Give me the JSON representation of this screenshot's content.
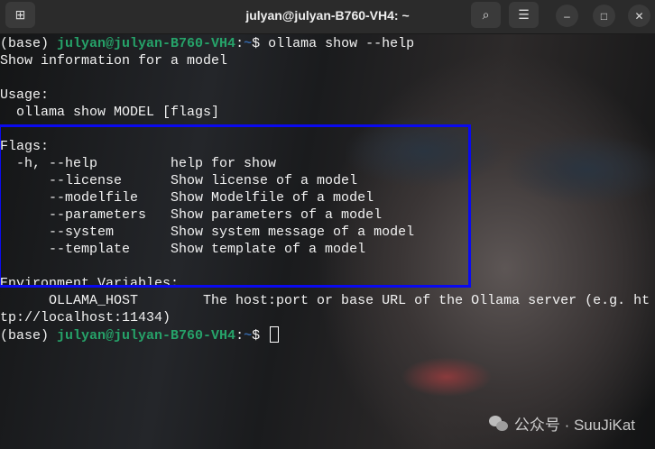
{
  "window": {
    "title": "julyan@julyan-B760-VH4: ~"
  },
  "prompt": {
    "env": "(base) ",
    "user_host": "julyan@julyan-B760-VH4",
    "colon": ":",
    "path": "~",
    "dollar": "$ "
  },
  "lines": [
    {
      "cmd": "ollama show --help"
    },
    "Show information for a model",
    "",
    "Usage:",
    "  ollama show MODEL [flags]",
    "",
    "Flags:",
    "  -h, --help         help for show",
    "      --license      Show license of a model",
    "      --modelfile    Show Modelfile of a model",
    "      --parameters   Show parameters of a model",
    "      --system       Show system message of a model",
    "      --template     Show template of a model",
    "",
    "Environment Variables:",
    "      OLLAMA_HOST        The host:port or base URL of the Ollama server (e.g. ht",
    "tp://localhost:11434)"
  ],
  "watermark": "公众号 · SuuJiKat",
  "colors": {
    "highlight_box": "#0a0af0",
    "prompt_user": "#26a269",
    "prompt_path": "#3465a4"
  }
}
